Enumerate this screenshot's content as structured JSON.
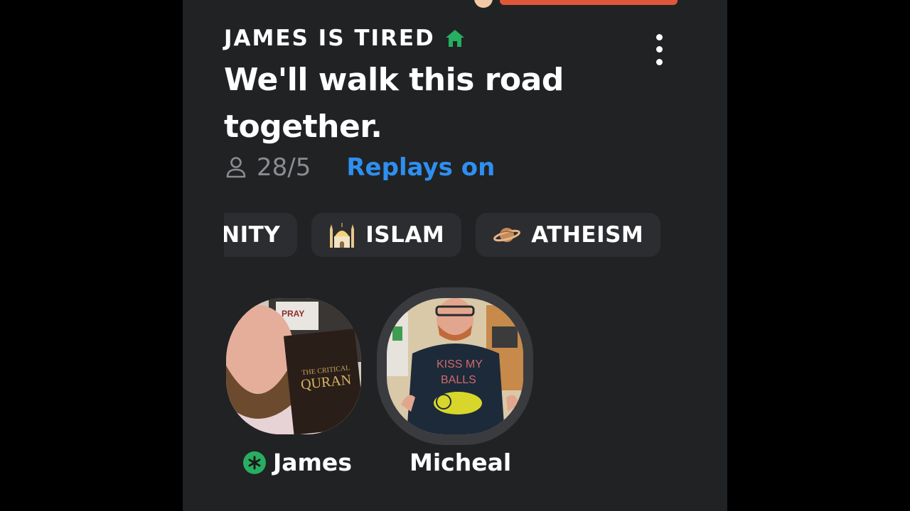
{
  "room": {
    "club_name": "JAMES IS TIRED",
    "title": "We'll walk this road together.",
    "listener_count": "28/5",
    "replays_label": "Replays on"
  },
  "icons": {
    "club": "home-icon",
    "menu": "more-vertical-icon",
    "listeners": "person-icon",
    "moderator": "moderator-badge-icon"
  },
  "tags": [
    {
      "label": "TIANITY",
      "icon": ""
    },
    {
      "label": "ISLAM",
      "icon": "mosque-icon"
    },
    {
      "label": "ATHEISM",
      "icon": "ringed-planet-icon"
    }
  ],
  "speakers": [
    {
      "name": "James",
      "moderator": true
    },
    {
      "name": "Micheal",
      "moderator": false
    }
  ],
  "colors": {
    "background": "#212224",
    "accent_green": "#27ae60",
    "link_blue": "#2f8ff0",
    "chip": "#2c2d30",
    "muted_text": "#8a8c90"
  }
}
